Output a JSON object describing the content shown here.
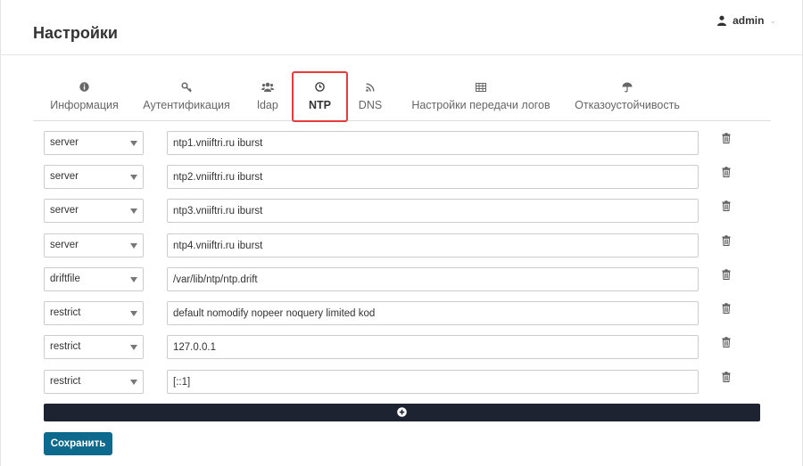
{
  "header": {
    "title": "Настройки",
    "user": "admin"
  },
  "tabs": [
    {
      "label": "Информация",
      "icon": "info-icon"
    },
    {
      "label": "Аутентификация",
      "icon": "key-icon"
    },
    {
      "label": "ldap",
      "icon": "users-icon"
    },
    {
      "label": "NTP",
      "icon": "clock-icon",
      "active": true
    },
    {
      "label": "DNS",
      "icon": "rss-icon"
    },
    {
      "label": "Настройки передачи логов",
      "icon": "table-icon"
    },
    {
      "label": "Отказоустойчивость",
      "icon": "umbrella-icon"
    }
  ],
  "rows": [
    {
      "type": "server",
      "value": "ntp1.vniiftri.ru iburst"
    },
    {
      "type": "server",
      "value": "ntp2.vniiftri.ru iburst"
    },
    {
      "type": "server",
      "value": "ntp3.vniiftri.ru iburst"
    },
    {
      "type": "server",
      "value": "ntp4.vniiftri.ru iburst"
    },
    {
      "type": "driftfile",
      "value": "/var/lib/ntp/ntp.drift"
    },
    {
      "type": "restrict",
      "value": "default nomodify nopeer noquery limited kod"
    },
    {
      "type": "restrict",
      "value": "127.0.0.1"
    },
    {
      "type": "restrict",
      "value": "[::1]"
    }
  ],
  "actions": {
    "save_label": "Сохранить"
  },
  "colors": {
    "active_tab_border": "#e53b3b",
    "save_button": "#0e6a8c",
    "add_bar": "#1d2330"
  }
}
